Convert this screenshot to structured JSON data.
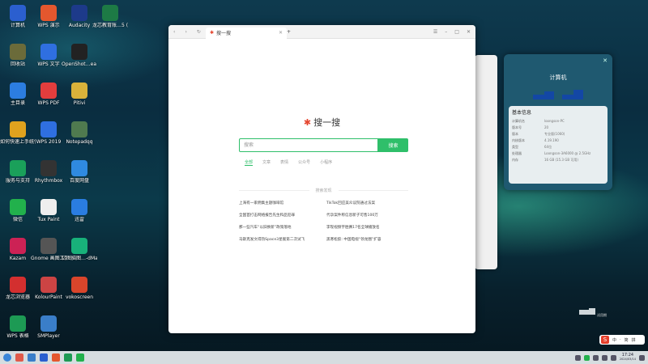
{
  "desktop": {
    "icons": [
      {
        "label": "计算机",
        "icon": "computer-icon",
        "color": "#2b5fcf"
      },
      {
        "label": "WPS 演示",
        "icon": "wps-presentation-icon",
        "color": "#e4572e"
      },
      {
        "label": "Audacity",
        "icon": "audacity-icon",
        "color": "#1d3a8a"
      },
      {
        "label": "龙芯教育账…5 (1).xlsx",
        "icon": "excel-file-icon",
        "color": "#1d7a45"
      },
      {
        "label": "回收站",
        "icon": "trash-icon",
        "color": "#6b6b3a"
      },
      {
        "label": "WPS 文字",
        "icon": "wps-writer-icon",
        "color": "#2f6fe0"
      },
      {
        "label": "OpenShot…ea Editor",
        "icon": "openshot-icon",
        "color": "#222"
      },
      {
        "label": "主目录",
        "icon": "home-folder-icon",
        "color": "#2c7de0"
      },
      {
        "label": "WPS PDF",
        "icon": "wps-pdf-icon",
        "color": "#e33d3d"
      },
      {
        "label": "Pitivi",
        "icon": "pitivi-icon",
        "color": "#d9b23a"
      },
      {
        "label": "如何快速上手统信UOS",
        "icon": "help-manual-icon",
        "color": "#e0a21e"
      },
      {
        "label": "WPS 2019",
        "icon": "wps-2019-icon",
        "color": "#2f6fe0"
      },
      {
        "label": "Notepadqq",
        "icon": "notepadqq-icon",
        "color": "#4f7a4f"
      },
      {
        "label": "服务与支持",
        "icon": "support-icon",
        "color": "#1aa05a"
      },
      {
        "label": "Rhythmbox",
        "icon": "rhythmbox-icon",
        "color": "#333"
      },
      {
        "label": "百度网盘",
        "icon": "baidu-netdisk-icon",
        "color": "#2f8ae0"
      },
      {
        "label": "微信",
        "icon": "wechat-icon",
        "color": "#22b14c"
      },
      {
        "label": "Tux Paint",
        "icon": "tuxpaint-icon",
        "color": "#eee"
      },
      {
        "label": "迅雷",
        "icon": "xunlei-icon",
        "color": "#2a7de1"
      },
      {
        "label": "Kazam",
        "icon": "kazam-icon",
        "color": "#cc2255"
      },
      {
        "label": "Gnome 画图工具",
        "icon": "gnome-paint-icon",
        "color": "#555"
      },
      {
        "label": "亿图脑图…-dMaster",
        "icon": "mindmaster-icon",
        "color": "#18b17a"
      },
      {
        "label": "龙芯浏览器",
        "icon": "loongson-browser-icon",
        "color": "#d32f2f"
      },
      {
        "label": "KolourPaint",
        "icon": "kolourpaint-icon",
        "color": "#c44"
      },
      {
        "label": "vokoscreen",
        "icon": "vokoscreen-icon",
        "color": "#d9452b"
      },
      {
        "label": "WPS 表格",
        "icon": "wps-spreadsheet-icon",
        "color": "#1d9a54"
      },
      {
        "label": "SMPlayer",
        "icon": "smplayer-icon",
        "color": "#3a7ec9"
      }
    ]
  },
  "browser": {
    "tab_title": "搜一搜",
    "logo_text": "搜一搜",
    "search_placeholder": "搜索",
    "search_button": "搜索",
    "search_tabs": [
      "全部",
      "文章",
      "表情",
      "公众号",
      "小程序"
    ],
    "hot_title": "搜索发现",
    "hot_items": [
      "上海有一家佣集主题咖啡馆",
      "TikTok回应美众议院通过法案",
      "全国首打击网络报告先生和品犯罪",
      "代孕案件称信息新子可售100万",
      "那一些汽车“以旧换新”政策落地",
      "李现视频宇胜赛17名全球播放名",
      "马斯克发文得热Space3星舰第二次试飞",
      "黑寒松胶: 中国电视“领龙圈”扩容"
    ]
  },
  "computer_window": {
    "title": "计算机",
    "section_title": "基本信息",
    "rows": [
      {
        "k": "计算机名",
        "v": "loongson-PC"
      },
      {
        "k": "版本号",
        "v": "20"
      },
      {
        "k": "版本",
        "v": "专业版(1060)"
      },
      {
        "k": "内核版本",
        "v": "4.19.190"
      },
      {
        "k": "类型",
        "v": "64位"
      },
      {
        "k": "处理器",
        "v": "Loongson-3A6000 @ 2.5GHz"
      },
      {
        "k": "内存",
        "v": "16 GB (15.3 GB 可用)"
      }
    ]
  },
  "desktop_misc": {
    "activate_label": "试用期"
  },
  "ime": {
    "logo": "S",
    "items": [
      "中",
      "·",
      "简",
      "拼"
    ]
  },
  "taskbar": {
    "time": "17:24",
    "date": "2024/03/14",
    "apps": [
      "#e05a4a",
      "#3a7ec9",
      "#2b5fcf",
      "#e4572e",
      "#1d9a54",
      "#22b14c"
    ]
  }
}
